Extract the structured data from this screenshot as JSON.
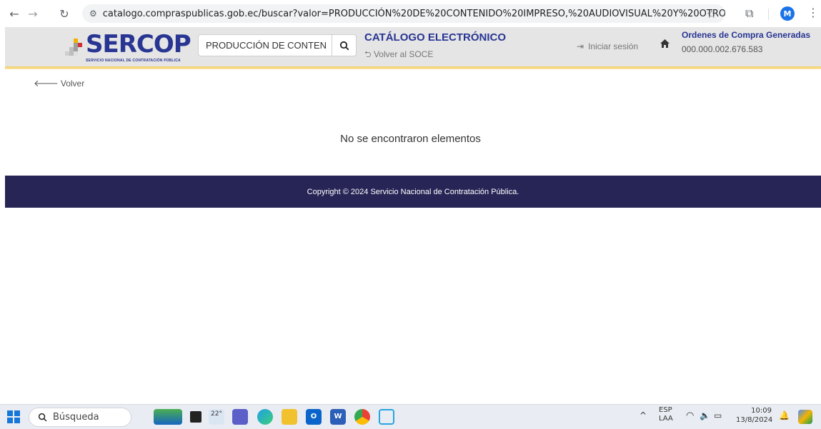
{
  "browser": {
    "url": "catalogo.compraspublicas.gob.ec/buscar?valor=PRODUCCIÓN%20DE%20CONTENIDO%20IMPRESO,%20AUDIOVISUAL%20Y%20OTROS%20MATERIAL...",
    "profile_initial": "M"
  },
  "header": {
    "logo_text": "SERCOP",
    "logo_subtitle": "SERVICIO NACIONAL DE CONTRATACIÓN PÚBLICA",
    "search_value": "PRODUCCIÓN DE CONTEN",
    "catalog_title": "CATÁLOGO ELECTRÓNICO",
    "soce_link": "Volver al SOCE",
    "login_label": "Iniciar sesión",
    "orders_title": "Ordenes de Compra Generadas",
    "orders_value": "000.000.002.676.583"
  },
  "main": {
    "back_label": "Volver",
    "empty_message": "No se encontraron elementos"
  },
  "footer": {
    "copyright": "Copyright © 2024 Servicio Nacional de Contratación Pública."
  },
  "taskbar": {
    "search_placeholder": "Búsqueda",
    "weather_temp": "22°",
    "lang_line1": "ESP",
    "lang_line2": "LAA",
    "time": "10:09",
    "date": "13/8/2024"
  },
  "colors": {
    "brand_blue": "#283593",
    "footer_bg": "#272556",
    "accent_gold": "#f3cf64"
  }
}
